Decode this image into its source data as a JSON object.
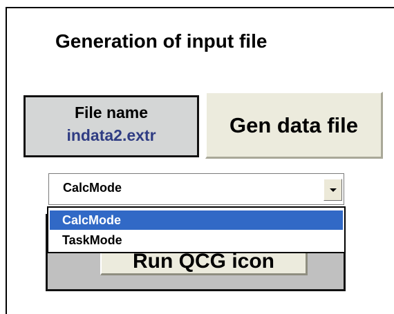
{
  "panel": {
    "title": "Generation of input file"
  },
  "file_name": {
    "label": "File name",
    "value": "indata2.extr"
  },
  "buttons": {
    "gen_data_file": "Gen data file",
    "run_qcg_icon": "Run QCG icon"
  },
  "mode_select": {
    "value": "CalcMode",
    "options": [
      "CalcMode",
      "TaskMode"
    ],
    "highlighted": "CalcMode"
  },
  "colors": {
    "file_name_value": "#2f3c83",
    "file_name_bg": "#d4d6d6",
    "button_bg": "#ecebdd",
    "run_area_bg": "#c0c0c0",
    "selection_bg": "#3169c6"
  }
}
